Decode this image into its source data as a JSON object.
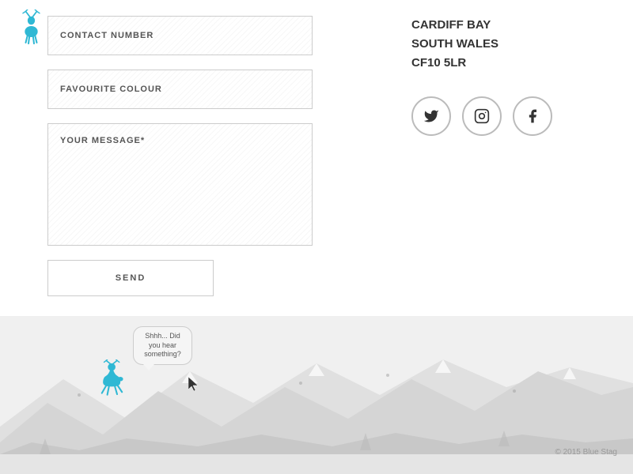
{
  "stag_logo_alt": "Blue Stag Logo",
  "form": {
    "contact_number_label": "CONTACT NUMBER",
    "favourite_colour_label": "FAVOURITE COLOUR",
    "message_label": "YOUR MESSAGE*",
    "send_button_label": "SEND"
  },
  "address": {
    "line1": "CARDIFF BAY",
    "line2": "SOUTH WALES",
    "line3": "CF10 5LR"
  },
  "social": {
    "twitter_label": "Twitter",
    "instagram_label": "Instagram",
    "facebook_label": "Facebook"
  },
  "speech_bubble": {
    "text": "Shhh... Did you hear something?"
  },
  "copyright": "© 2015 Blue Stag"
}
